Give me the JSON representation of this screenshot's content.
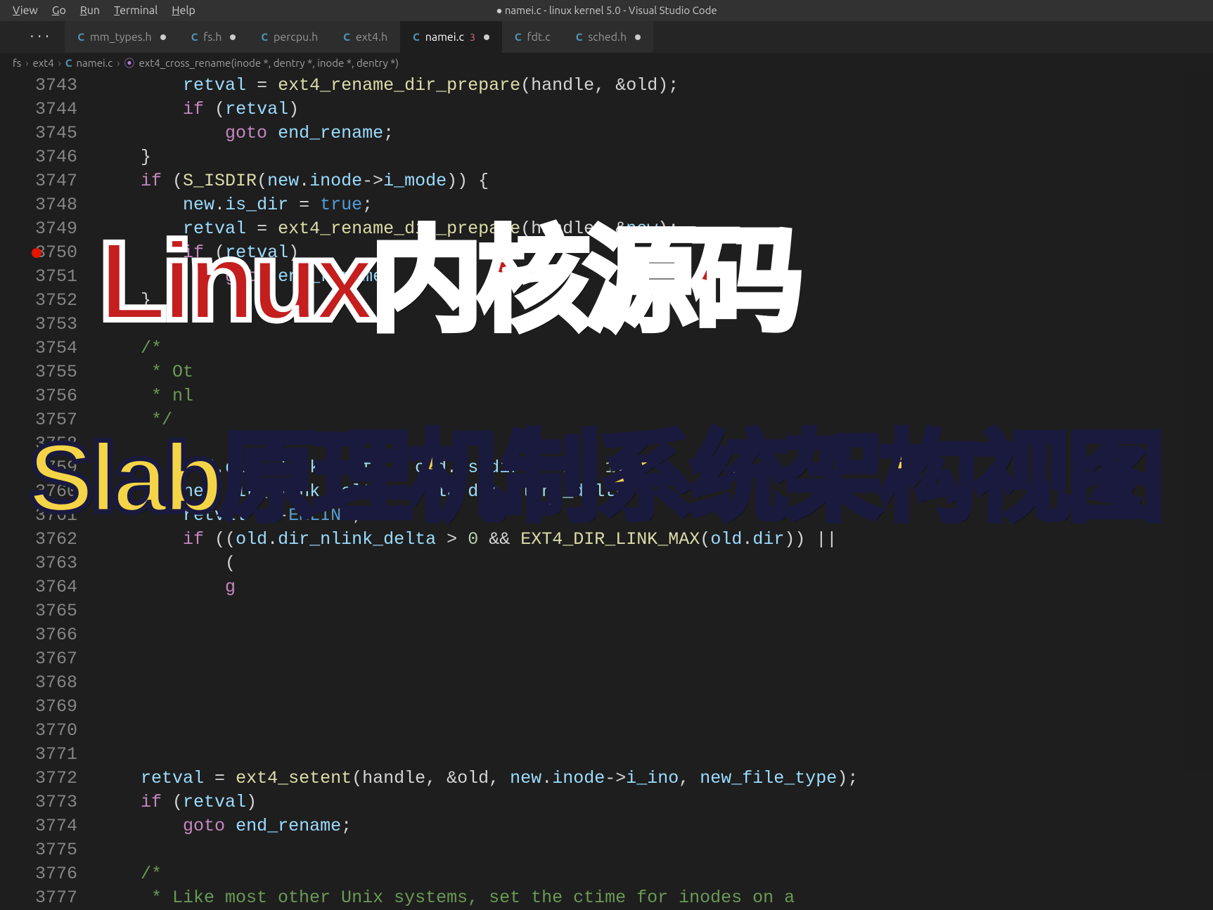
{
  "window_title": "● namei.c - linux kernel 5.0 - Visual Studio Code",
  "menubar": [
    "View",
    "Go",
    "Run",
    "Terminal",
    "Help"
  ],
  "tabs": [
    {
      "icon": "C",
      "label": "mm_types.h",
      "modified": true,
      "active": false
    },
    {
      "icon": "C",
      "label": "fs.h",
      "modified": true,
      "active": false
    },
    {
      "icon": "C",
      "label": "percpu.h",
      "modified": false,
      "active": false
    },
    {
      "icon": "C",
      "label": "ext4.h",
      "modified": false,
      "active": false
    },
    {
      "icon": "C",
      "label": "namei.c",
      "modified": true,
      "active": true,
      "badge": "3"
    },
    {
      "icon": "C",
      "label": "fdt.c",
      "modified": false,
      "active": false
    },
    {
      "icon": "C",
      "label": "sched.h",
      "modified": true,
      "active": false
    }
  ],
  "breadcrumb": {
    "segments": [
      "fs",
      "ext4"
    ],
    "file": "namei.c",
    "file_icon": "C",
    "fn_icon": "⦿",
    "function": "ext4_cross_rename(inode *, dentry *, inode *, dentry *)"
  },
  "code_start_line": 3743,
  "code_lines": [
    {
      "n": 3743,
      "html": "        <span class='v'>retval</span> <span class='op'>=</span> <span class='fn'>ext4_rename_dir_prepare</span>(handle, <span class='op'>&amp;</span>old);"
    },
    {
      "n": 3744,
      "html": "        <span class='k'>if</span> (<span class='v'>retval</span>)"
    },
    {
      "n": 3745,
      "html": "            <span class='k'>goto</span> <span class='v'>end_rename</span>;"
    },
    {
      "n": 3746,
      "html": "    }"
    },
    {
      "n": 3747,
      "html": "    <span class='k'>if</span> (<span class='fn'>S_ISDIR</span>(<span class='v'>new</span>.<span class='v'>inode</span><span class='op'>-&gt;</span><span class='v'>i_mode</span>)) {"
    },
    {
      "n": 3748,
      "html": "        <span class='v'>new</span>.<span class='v'>is_dir</span> <span class='op'>=</span> <span class='bool'>true</span>;"
    },
    {
      "n": 3749,
      "html": "        <span class='v'>retval</span> <span class='op'>=</span> <span class='fn'>ext4_rename_dir_prepare</span>(handle, <span class='op'>&amp;</span><span class='v'>new</span>);"
    },
    {
      "n": 3750,
      "html": "        <span class='k'>if</span> (<span class='v'>retval</span>)"
    },
    {
      "n": 3751,
      "html": "            <span class='k'>goto</span> <span class='v'>end_rename</span>;"
    },
    {
      "n": 3752,
      "html": "    }"
    },
    {
      "n": 3753,
      "html": ""
    },
    {
      "n": 3754,
      "html": "    <span class='c'>/*</span>"
    },
    {
      "n": 3755,
      "html": "    <span class='c'> * Ot</span>"
    },
    {
      "n": 3756,
      "html": "    <span class='c'> * nl</span>"
    },
    {
      "n": 3757,
      "html": "    <span class='c'> */</span>"
    },
    {
      "n": 3758,
      "html": "    <span class='k'></span>"
    },
    {
      "n": 3759,
      "html": "        <span class='v'>old</span>.<span class='v'>dir_nlink_delta</span> <span class='op'>=</span> <span class='v'>old</span>.<span class='v'>is_dir</span> <span class='op'>?</span> <span class='n'>-1</span> <span class='op'>:</span> <span class='n'>1</span>;"
    },
    {
      "n": 3760,
      "html": "        <span class='v'>new</span>.<span class='v'>dir_nlink_delta</span> <span class='op'>=</span> <span class='op'>-</span><span class='v'>old</span>.<span class='v'>dir_nlink_delta</span>;"
    },
    {
      "n": 3761,
      "html": "        <span class='v'>retval</span> <span class='op'>=</span> <span class='op'>-</span><span class='s'>EMLINK</span>;"
    },
    {
      "n": 3762,
      "html": "        <span class='k'>if</span> ((<span class='v'>old</span>.<span class='v'>dir_nlink_delta</span> <span class='op'>&gt;</span> <span class='n'>0</span> <span class='op'>&amp;&amp;</span> <span class='fn'>EXT4_DIR_LINK_MAX</span>(<span class='v'>old</span>.<span class='v'>dir</span>)) <span class='op'>||</span>"
    },
    {
      "n": 3763,
      "html": "            ("
    },
    {
      "n": 3764,
      "html": "            <span class='k'>g</span>"
    },
    {
      "n": 3765,
      "html": ""
    },
    {
      "n": 3766,
      "html": ""
    },
    {
      "n": 3767,
      "html": ""
    },
    {
      "n": 3768,
      "html": ""
    },
    {
      "n": 3769,
      "html": ""
    },
    {
      "n": 3770,
      "html": ""
    },
    {
      "n": 3771,
      "html": ""
    },
    {
      "n": 3772,
      "html": "    <span class='v'>retval</span> <span class='op'>=</span> <span class='fn'>ext4_setent</span>(handle, <span class='op'>&amp;</span>old, <span class='v'>new</span>.<span class='v'>inode</span><span class='op'>-&gt;</span><span class='v'>i_ino</span>, <span class='v'>new_file_type</span>);"
    },
    {
      "n": 3773,
      "html": "    <span class='k'>if</span> (<span class='v'>retval</span>)"
    },
    {
      "n": 3774,
      "html": "        <span class='k'>goto</span> <span class='v'>end_rename</span>;"
    },
    {
      "n": 3775,
      "html": ""
    },
    {
      "n": 3776,
      "html": "    <span class='c'>/*</span>"
    },
    {
      "n": 3777,
      "html": "    <span class='c'> * Like most other Unix systems, set the ctime for inodes on a</span>"
    }
  ],
  "overlay": {
    "red": "Linux内核源码",
    "yellow": "Slab原理机制系统架构视图"
  },
  "breakpoints": [
    3750
  ]
}
